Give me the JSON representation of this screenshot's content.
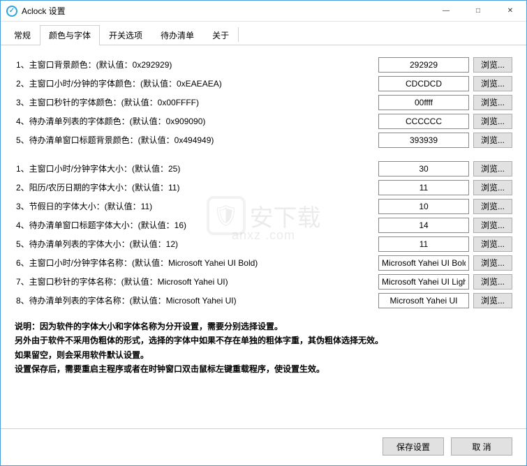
{
  "window": {
    "title": "Aclock 设置"
  },
  "tabs": [
    "常规",
    "颜色与字体",
    "开关选项",
    "待办清单",
    "关于"
  ],
  "activeTab": 1,
  "group1": [
    {
      "label": "1、主窗口背景颜色：(默认值：0x292929)",
      "value": "292929",
      "btn": "浏览..."
    },
    {
      "label": "2、主窗口小时/分钟的字体颜色：(默认值：0xEAEAEA)",
      "value": "CDCDCD",
      "btn": "浏览..."
    },
    {
      "label": "3、主窗口秒针的字体颜色：(默认值：0x00FFFF)",
      "value": "00ffff",
      "btn": "浏览..."
    },
    {
      "label": "4、待办清单列表的字体颜色：(默认值：0x909090)",
      "value": "CCCCCC",
      "btn": "浏览..."
    },
    {
      "label": "5、待办清单窗口标题背景颜色：(默认值：0x494949)",
      "value": "393939",
      "btn": "浏览..."
    }
  ],
  "group2": [
    {
      "label": "1、主窗口小时/分钟字体大小：(默认值：25)",
      "value": "30",
      "btn": "浏览..."
    },
    {
      "label": "2、阳历/农历日期的字体大小：(默认值：11)",
      "value": "11",
      "btn": "浏览..."
    },
    {
      "label": "3、节假日的字体大小：(默认值：11)",
      "value": "10",
      "btn": "浏览..."
    },
    {
      "label": "4、待办清单窗口标题字体大小：(默认值：16)",
      "value": "14",
      "btn": "浏览..."
    },
    {
      "label": "5、待办清单列表的字体大小：(默认值：12)",
      "value": "11",
      "btn": "浏览..."
    },
    {
      "label": "6、主窗口小时/分钟字体名称：(默认值：Microsoft Yahei UI Bold)",
      "value": "Microsoft Yahei UI Bold",
      "btn": "浏览..."
    },
    {
      "label": "7、主窗口秒针的字体名称：(默认值：Microsoft Yahei UI)",
      "value": "Microsoft Yahei UI Light",
      "btn": "浏览..."
    },
    {
      "label": "8、待办清单列表的字体名称：(默认值：Microsoft Yahei UI)",
      "value": "Microsoft Yahei UI",
      "btn": "浏览..."
    }
  ],
  "desc": {
    "l1": "说明：因为软件的字体大小和字体名称为分开设置，需要分别选择设置。",
    "l2": "另外由于软件不采用伪粗体的形式，选择的字体中如果不存在单独的粗体字重，其伪粗体选择无效。",
    "l3": "如果留空，则会采用软件默认设置。",
    "l4": "设置保存后，需要重启主程序或者在时钟窗口双击鼠标左键重载程序，使设置生效。"
  },
  "footer": {
    "save": "保存设置",
    "cancel": "取 消"
  },
  "watermark": {
    "main": "安下载",
    "sub": "anxz .com"
  }
}
